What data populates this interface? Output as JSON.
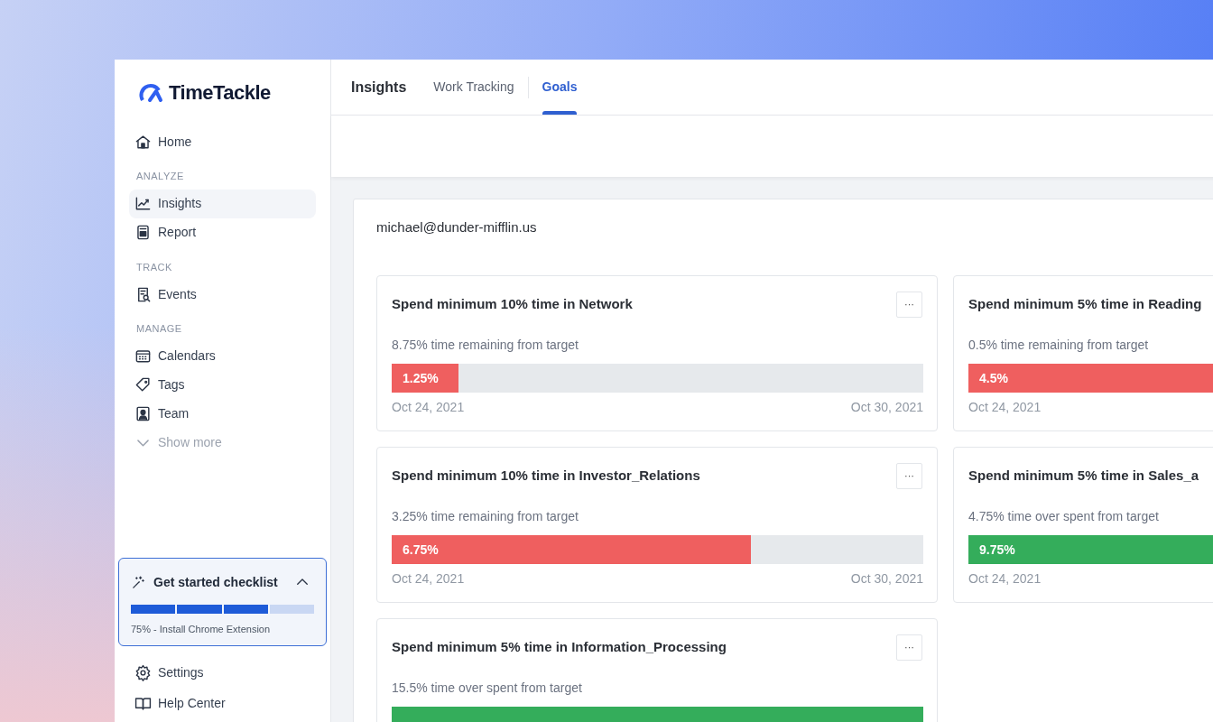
{
  "logo": {
    "text": "TimeTackle"
  },
  "sidebar": {
    "sections": [
      {
        "items": [
          {
            "label": "Home",
            "selected": false,
            "kind": "link"
          }
        ]
      },
      {
        "heading": "ANALYZE",
        "items": [
          {
            "label": "Insights",
            "selected": true,
            "kind": "link"
          },
          {
            "label": "Report",
            "selected": false,
            "kind": "link"
          }
        ]
      },
      {
        "heading": "TRACK",
        "items": [
          {
            "label": "Events",
            "selected": false,
            "kind": "link"
          }
        ]
      },
      {
        "heading": "MANAGE",
        "items": [
          {
            "label": "Calendars",
            "selected": false,
            "kind": "link"
          },
          {
            "label": "Tags",
            "selected": false,
            "kind": "link"
          },
          {
            "label": "Team",
            "selected": false,
            "kind": "link"
          },
          {
            "label": "Show more",
            "selected": false,
            "kind": "more"
          }
        ]
      }
    ],
    "checklist": {
      "title": "Get started checklist",
      "expanded": true,
      "segments": [
        {
          "done": true
        },
        {
          "done": true
        },
        {
          "done": true
        },
        {
          "done": false
        }
      ],
      "caption": "75% - Install Chrome Extension"
    },
    "footer_items": [
      {
        "label": "Settings"
      },
      {
        "label": "Help Center"
      }
    ]
  },
  "header": {
    "title": "Insights",
    "tabs": [
      {
        "label": "Work Tracking",
        "selected": false
      },
      {
        "label": "Goals",
        "selected": true
      }
    ]
  },
  "panel": {
    "user": "michael@dunder-mifflin.us",
    "goals": [
      {
        "title": "Spend minimum 10% time in Network",
        "menu": "···",
        "summary": "8.75% time remaining from target",
        "value": "1.25%",
        "level": 0.125,
        "color": "#ef5f5f",
        "start": "Oct 24, 2021",
        "end": "Oct 30, 2021"
      },
      {
        "title": "Spend minimum 5% time in Reading",
        "summary": "0.5% time remaining from target",
        "value": "4.5%",
        "level": 0.9,
        "color": "#ef5f5f",
        "start": "Oct 24, 2021"
      },
      {
        "title": "Spend minimum 10% time in Investor_Relations",
        "menu": "···",
        "summary": "3.25% time remaining from target",
        "value": "6.75%",
        "level": 0.675,
        "color": "#ef5f5f",
        "start": "Oct 24, 2021",
        "end": "Oct 30, 2021"
      },
      {
        "title": "Spend minimum 5% time in Sales_a",
        "summary": "4.75% time over spent from target",
        "value": "9.75%",
        "level": 1,
        "color": "#34ad5b",
        "start": "Oct 24, 2021"
      },
      {
        "title": "Spend minimum 5% time in Information_Processing",
        "menu": "···",
        "summary": "15.5% time over spent from target",
        "level": 1,
        "color": "#34ad5b"
      }
    ]
  }
}
